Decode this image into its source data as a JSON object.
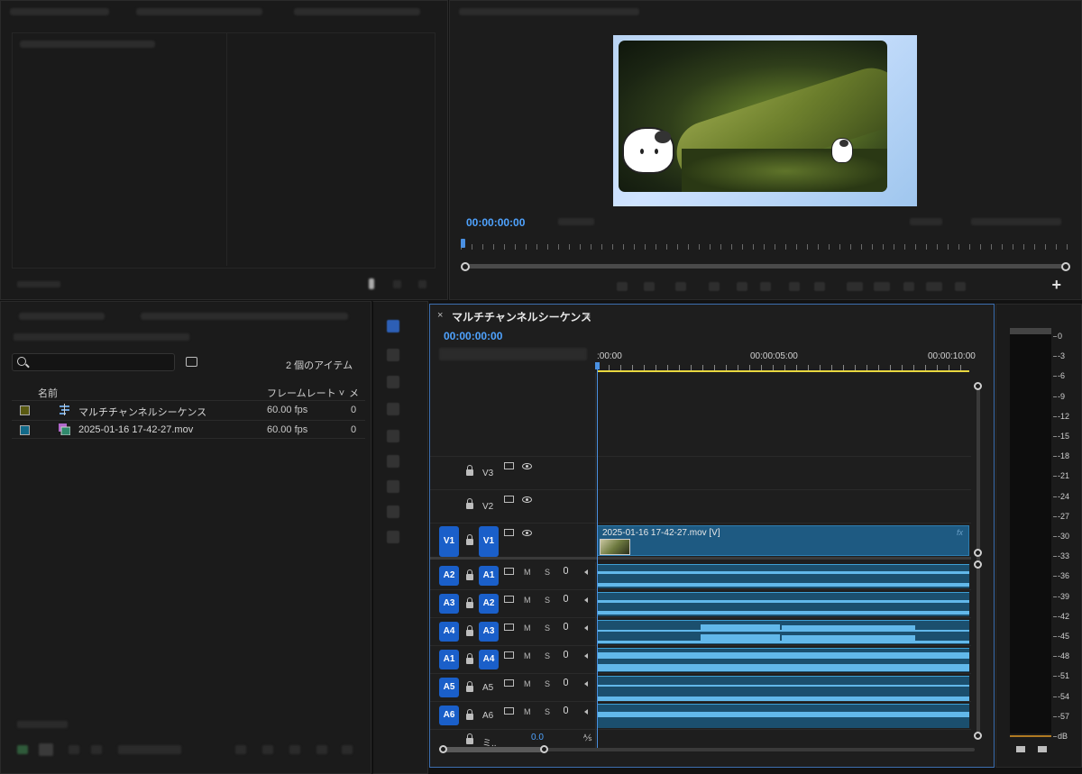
{
  "program": {
    "timecode": "00:00:00:00",
    "add_label": "+"
  },
  "project": {
    "item_count": "2 個のアイテム",
    "columns": {
      "name": "名前",
      "frame_rate": "フレームレート ˅",
      "more": "メ"
    },
    "rows": [
      {
        "name": "マルチチャンネルシーケンス",
        "fps": "60.00 fps",
        "more": "0",
        "color": "#5a5a12"
      },
      {
        "name": "2025-01-16 17-42-27.mov",
        "fps": "60.00 fps",
        "more": "0",
        "color": "#126a8a"
      }
    ]
  },
  "timeline": {
    "close": "×",
    "title": "マルチチャンネルシーケンス",
    "menu": "≡",
    "timecode": "00:00:00:00",
    "ruler": [
      ":00:00",
      "00:00:05:00",
      "00:00:10:00"
    ],
    "video_clip_label": "2025-01-16 17-42-27.mov [V]",
    "fx": "fx",
    "video_tracks": [
      {
        "id": "V3",
        "label": "V3"
      },
      {
        "id": "V2",
        "label": "V2"
      },
      {
        "id": "V1",
        "source": "V1",
        "label": "V1"
      }
    ],
    "audio_tracks": [
      {
        "source": "A2",
        "label": "A1",
        "m": "M",
        "s": "S"
      },
      {
        "source": "A3",
        "label": "A2",
        "m": "M",
        "s": "S"
      },
      {
        "source": "A4",
        "label": "A3",
        "m": "M",
        "s": "S"
      },
      {
        "source": "A1",
        "label": "A4",
        "m": "M",
        "s": "S"
      },
      {
        "source": "A5",
        "label": "A5",
        "m": "M",
        "s": "S"
      },
      {
        "source": "A6",
        "label": "A6",
        "m": "M",
        "s": "S"
      }
    ],
    "master": {
      "label": "ミ..",
      "value": "0.0"
    }
  },
  "meter": {
    "labels": [
      "0",
      "-3",
      "-6",
      "-9",
      "-12",
      "-15",
      "-18",
      "-21",
      "-24",
      "-27",
      "-30",
      "-33",
      "-36",
      "-39",
      "-42",
      "-45",
      "-48",
      "-51",
      "-54",
      "-57",
      "dB"
    ]
  }
}
